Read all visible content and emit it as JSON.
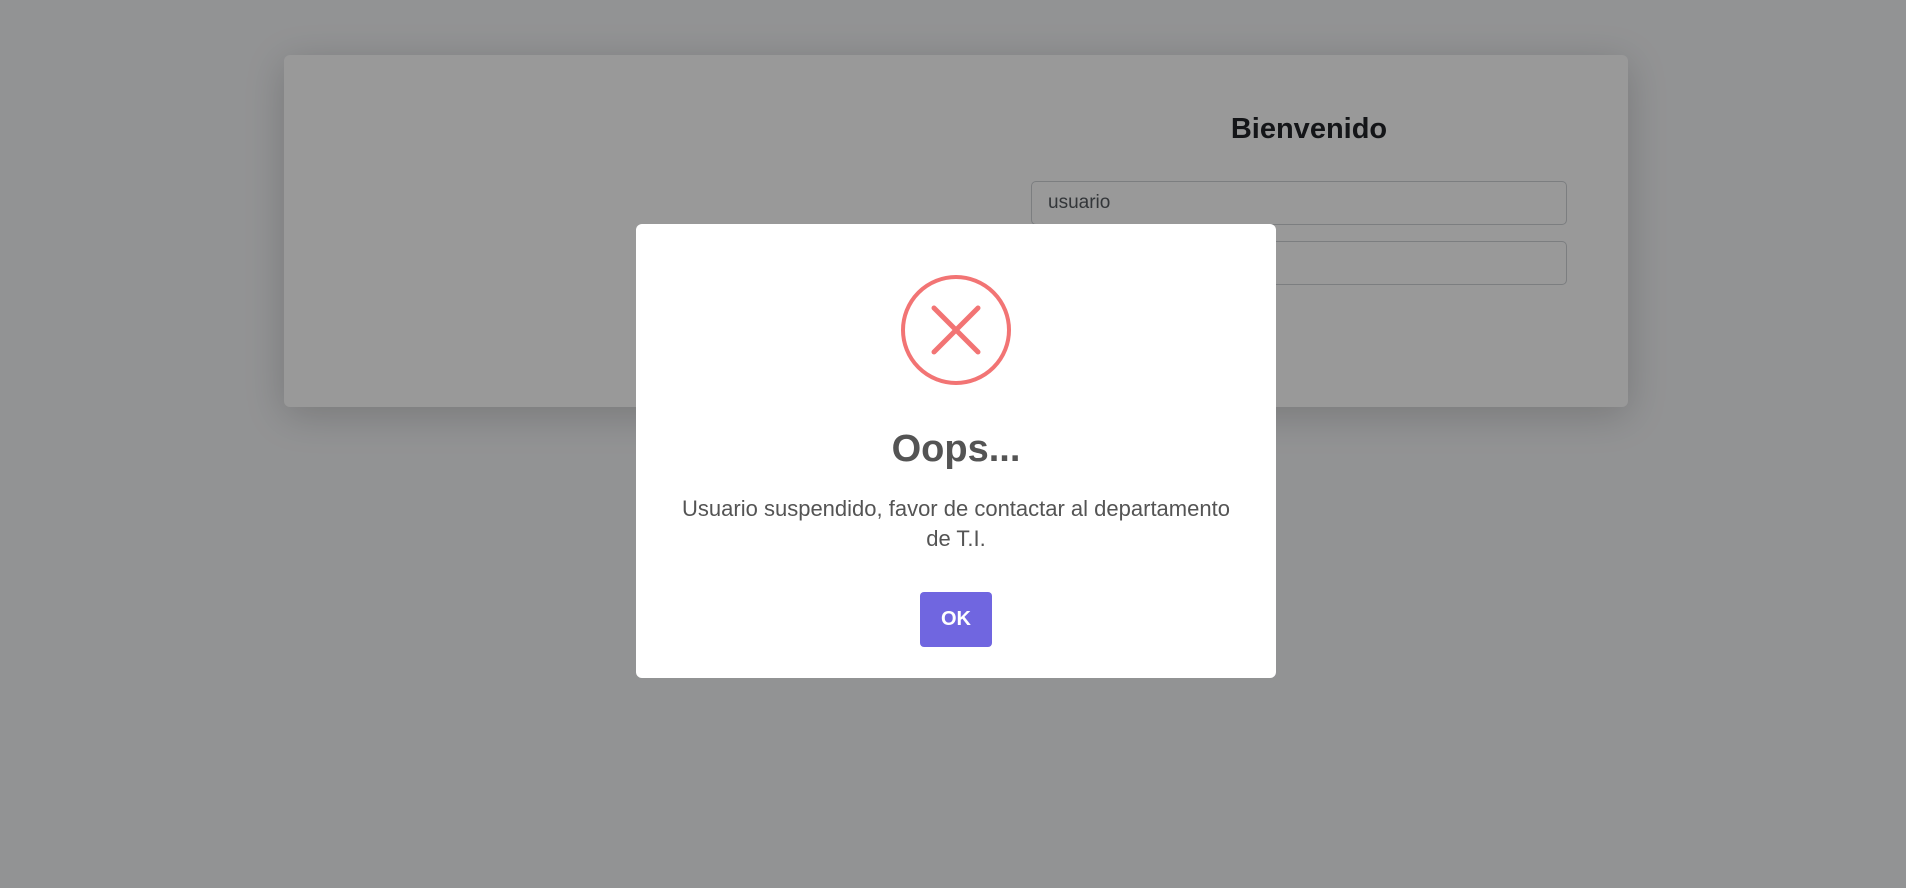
{
  "login": {
    "title": "Bienvenido",
    "username_value": "usuario",
    "password_value": ""
  },
  "alert": {
    "icon": "error-x-icon",
    "title": "Oops...",
    "message": "Usuario suspendido, favor de contactar al departamento de T.I.",
    "confirm_label": "OK"
  },
  "colors": {
    "overlay": "#000000",
    "error_icon": "#f27474",
    "confirm_button": "#7066e0",
    "text": "#545454"
  }
}
